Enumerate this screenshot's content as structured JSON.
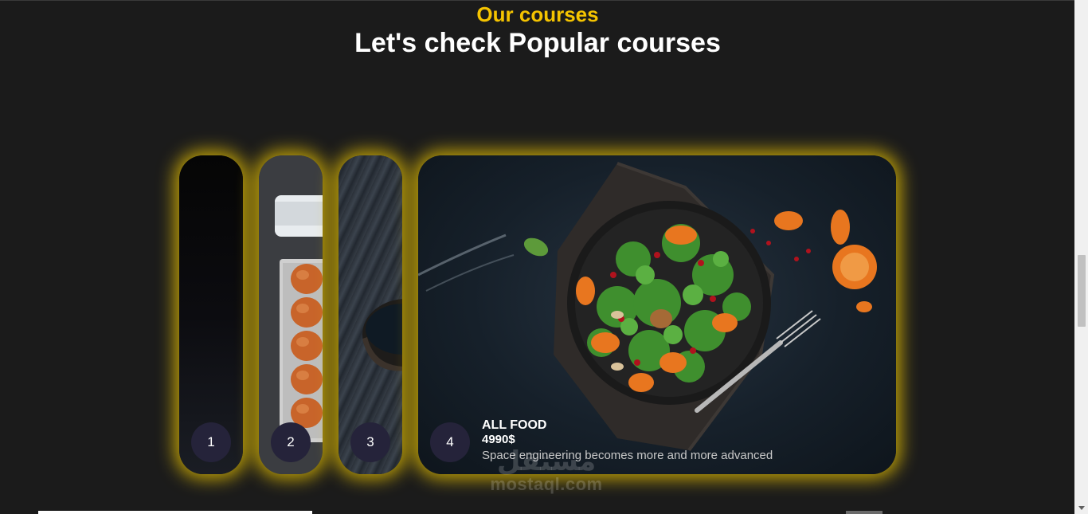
{
  "section": {
    "eyebrow": "Our courses",
    "heading": "Let's check Popular courses"
  },
  "colors": {
    "accent": "#f5c400",
    "background": "#1b1b1b",
    "badge": "#25233a",
    "glow": "#f5cd00"
  },
  "cards": [
    {
      "number": "1",
      "image": "dark-gradient-image"
    },
    {
      "number": "2",
      "image": "eggs-and-milk-image"
    },
    {
      "number": "3",
      "image": "sauce-bowl-on-wood-image"
    },
    {
      "number": "4",
      "image": "salad-bowl-image",
      "title": "ALL FOOD",
      "price": "4990$",
      "description": "Space engineering becomes more and more advanced"
    }
  ],
  "watermark": {
    "logo": "مستقل",
    "text": "mostaql.com"
  }
}
